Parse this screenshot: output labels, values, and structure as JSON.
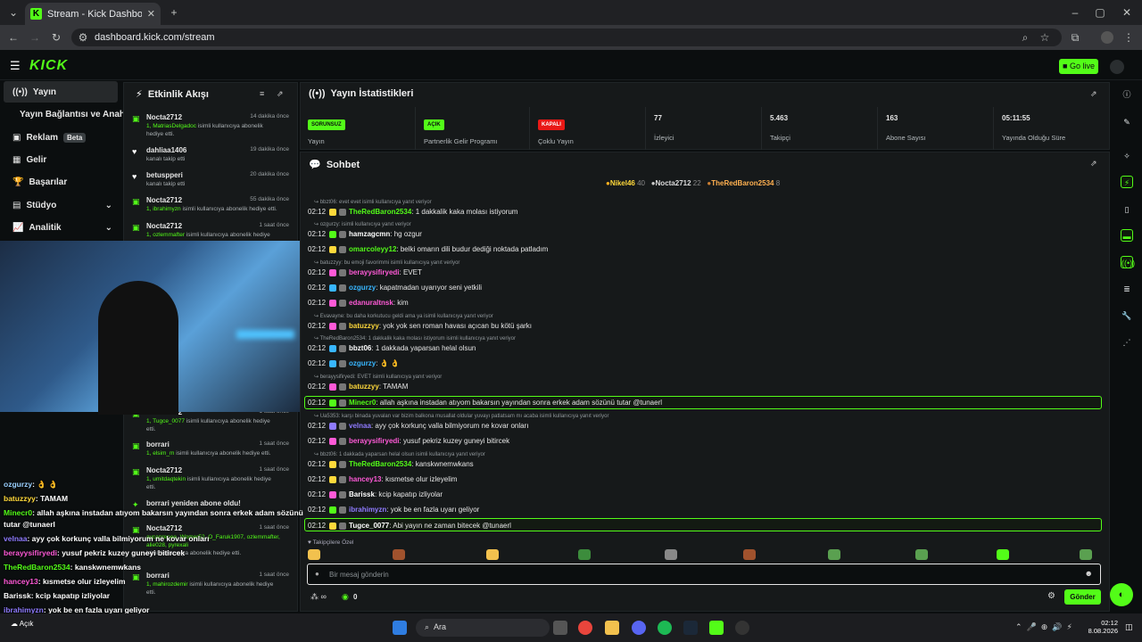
{
  "browser": {
    "tab_title": "Stream - Kick Dashboard",
    "url": "dashboard.kick.com/stream"
  },
  "header": {
    "logo": "KICK",
    "go_live": "Go live"
  },
  "sidebar": {
    "items": [
      {
        "label": "Yayın"
      },
      {
        "label": "Yayın Bağlantısı ve Anahtarı"
      },
      {
        "label": "Reklam",
        "badge": "Beta"
      },
      {
        "label": "Gelir"
      },
      {
        "label": "Başarılar"
      },
      {
        "label": "Stüdyo"
      },
      {
        "label": "Analitik"
      }
    ]
  },
  "activity": {
    "title": "Etkinlik Akışı",
    "items": [
      {
        "name": "Nocta2712",
        "time": "14 dakika önce",
        "line1_user": "1, MatriasDelgadoc",
        "line1": " isimli kullanıcıya abonelik",
        "line2": "hediye etti."
      },
      {
        "name": "dahliaa1406",
        "time": "19 dakika önce",
        "line1_user": "",
        "line1": "kanalı takip etti",
        "line2": ""
      },
      {
        "name": "betuspperi",
        "time": "20 dakika önce",
        "line1_user": "",
        "line1": "kanalı takip etti",
        "line2": ""
      },
      {
        "name": "Nocta2712",
        "time": "55 dakika önce",
        "line1_user": "1, ibrahimyzn",
        "line1": " isimli kullanıcıya abonelik hediye etti.",
        "line2": ""
      },
      {
        "name": "Nocta2712",
        "time": "1 saat önce",
        "line1_user": "1, ozlemmafter",
        "line1": " isimli kullanıcıya abonelik hediye",
        "line2": ""
      },
      {
        "name": "Nocta2712",
        "time": "1 saat önce",
        "line1_user": "1, Tugce_0077",
        "line1": " isimli kullanıcıya abonelik hediye",
        "line2": "etti."
      },
      {
        "name": "borrari",
        "time": "1 saat önce",
        "line1_user": "1, elsim_m",
        "line1": " isimli kullanıcıya abonelik hediye etti.",
        "line2": ""
      },
      {
        "name": "Nocta2712",
        "time": "1 saat önce",
        "line1_user": "1, umitdaqtekin",
        "line1": " isimli kullanıcıya abonelik hediye",
        "line2": "etti."
      },
      {
        "name": "borrari yeniden abone oldu!",
        "time": "",
        "line1_user": "",
        "line1": "",
        "line2": ""
      },
      {
        "name": "Nocta2712",
        "time": "1 saat önce",
        "line1_user": "aycanrenee, Womer52, O_Faruk1907, ozlemmafter, alie028, pyrexali",
        "line1": "",
        "line2": "isimli kullanıcıya abonelik hediye etti."
      },
      {
        "name": "borrari",
        "time": "1 saat önce",
        "line1_user": "1, mahirozdemir",
        "line1": " isimli kullanıcıya abonelik hediye",
        "line2": "etti."
      }
    ]
  },
  "stats": {
    "title": "Yayın İstatistikleri",
    "cells": [
      {
        "value": "SORUNSUZ",
        "label": "Yayın"
      },
      {
        "value": "AÇIK",
        "label": "Partnerlik Gelir Programı"
      },
      {
        "value": "KAPALI",
        "label": "Çoklu Yayın"
      },
      {
        "value": "77",
        "label": "İzleyici"
      },
      {
        "value": "5.463",
        "label": "Takipçi"
      },
      {
        "value": "163",
        "label": "Abone Sayısı"
      },
      {
        "value": "05:11:55",
        "label": "Yayında Olduğu Süre"
      }
    ]
  },
  "chat": {
    "title": "Sohbet",
    "leaderboard": [
      {
        "name": "Nikel46",
        "count": "40"
      },
      {
        "name": "Nocta2712",
        "count": "22"
      },
      {
        "name": "TheRedBaron2534",
        "count": "8"
      }
    ],
    "messages": [
      {
        "reply": "bbzt06: evet evet isimli kullanıcıya yanıt veriyor",
        "time": "02:12",
        "user": "TheRedBaron2534",
        "color": "#53fc18",
        "text": "1 dakkalik kaka molası istiyorum"
      },
      {
        "reply": "ozgurzy:  isimli kullanıcıya yanıt veriyor",
        "time": "02:12",
        "user": "hamzagcmn",
        "color": "#ffffff",
        "text": "hg ozgur"
      },
      {
        "reply": "",
        "time": "02:12",
        "user": "omarcoleyy12",
        "color": "#53fc18",
        "text": "belki omarın dili budur dediği noktada patladım"
      },
      {
        "reply": "batuzzyy: bu emoji favorimmi isimli kullanıcıya yanıt veriyor",
        "time": "02:12",
        "user": "berayysifiryedi",
        "color": "#ff5ad7",
        "text": "EVET"
      },
      {
        "reply": "",
        "time": "02:12",
        "user": "ozgurzy",
        "color": "#38b6ff",
        "text": "kapatmadan uyarıyor seni yetkili"
      },
      {
        "reply": "",
        "time": "02:12",
        "user": "edanuraltnsk",
        "color": "#ff5ad7",
        "text": "kim"
      },
      {
        "reply": "Evavayne: bu daha korkutucu geldi ama ya isimli kullanıcıya yanıt veriyor",
        "time": "02:12",
        "user": "batuzzyy",
        "color": "#ffd93b",
        "text": "yok yok sen roman havası açıcan bu kötü şarkı"
      },
      {
        "reply": "TheRedBaron2534: 1 dakkalik kaka molası istiyorum isimli kullanıcıya yanıt veriyor",
        "time": "02:12",
        "user": "bbzt06",
        "color": "#ffffff",
        "text": "1 dakkada yaparsan helal olsun"
      },
      {
        "reply": "",
        "time": "02:12",
        "user": "ozgurzy",
        "color": "#38b6ff",
        "text": "👌 👌"
      },
      {
        "reply": "berayysifiryedi: EVET isimli kullanıcıya yanıt veriyor",
        "time": "02:12",
        "user": "batuzzyy",
        "color": "#ffd93b",
        "text": "TAMAM"
      },
      {
        "reply": "",
        "time": "02:12",
        "user": "Minecr0",
        "color": "#53fc18",
        "text": "allah aşkına instadan atıyom bakarsın yayından sonra erkek adam sözünü tutar @tunaerl"
      },
      {
        "reply": "Ua5353: karşı binada yuvalan var bizim balkona musallat oldular yuvayı patlatsam mı acaba isimli kullanıcıya yanıt veriyor",
        "time": "02:12",
        "user": "velnaa",
        "color": "#8f7bff",
        "text": "ayy çok korkunç valla bilmiyorum ne kovar onları"
      },
      {
        "reply": "",
        "time": "02:12",
        "user": "berayysifiryedi",
        "color": "#ff5ad7",
        "text": "yusuf pekriz kuzey guneyi bitircek"
      },
      {
        "reply": "bbzt06: 1 dakkada yaparsan helal olsun isimli kullanıcıya yanıt veriyor",
        "time": "02:12",
        "user": "TheRedBaron2534",
        "color": "#53fc18",
        "text": "kanskwnemwkans"
      },
      {
        "reply": "",
        "time": "02:12",
        "user": "hancey13",
        "color": "#ff5ad7",
        "text": "kısmetse olur izleyelim"
      },
      {
        "reply": "",
        "time": "02:12",
        "user": "Barissk",
        "color": "#ffffff",
        "text": "kcip kapatıp izliyolar"
      },
      {
        "reply": "",
        "time": "02:12",
        "user": "ibrahimyzn",
        "color": "#8f7bff",
        "text": "yok be en fazla uyarı geliyor"
      },
      {
        "reply": "",
        "time": "02:12",
        "user": "Tugce_0077",
        "color": "#ffffff",
        "text": "Abi yayın ne zaman bitecek @tunaerl"
      }
    ],
    "emote_label": "Takipçilere Özel",
    "input_placeholder": "Bir mesaj gönderin",
    "points": "0",
    "send": "Gönder"
  },
  "overlay": {
    "lines": [
      {
        "user": "ozgurzy",
        "text": ": 👌 👌",
        "color": "#9ad0ff"
      },
      {
        "user": "batuzzyy",
        "text": ": TAMAM",
        "color": "#ffd93b"
      },
      {
        "user": "Minecr0",
        "text": ": allah aşkına instadan atıyom bakarsın yayından sonra erkek adam sözünü",
        "color": "#53fc18"
      },
      {
        "user": "",
        "text": "tutar @tunaerl",
        "color": "#ffffff"
      },
      {
        "user": "velnaa",
        "text": ": ayy çok korkunç valla bilmiyorum ne kovar onları",
        "color": "#8f7bff"
      },
      {
        "user": "berayysifiryedi",
        "text": ": yusuf pekriz kuzey guneyi bitircek",
        "color": "#ff5ad7"
      },
      {
        "user": "TheRedBaron2534",
        "text": ": kanskwnemwkans",
        "color": "#53fc18"
      },
      {
        "user": "hancey13",
        "text": ": kısmetse olur izleyelim",
        "color": "#ff5ad7"
      },
      {
        "user": "Barissk",
        "text": ": kcip kapatıp izliyolar",
        "color": "#ffffff"
      },
      {
        "user": "ibrahimyzn",
        "text": ": yok be en fazla uyarı geliyor",
        "color": "#8f7bff"
      },
      {
        "user": "Tugce_0077",
        "text": ": Abi yayın ne zaman bitecek @tunaerl",
        "color": "#ffffff"
      }
    ]
  },
  "taskbar": {
    "search": "Ara",
    "time": "02:12",
    "date": "8.08.2026",
    "weather": "Açık"
  },
  "colors": {
    "accent": "#53fc18",
    "bg": "#0b0e0f",
    "panel": "#16191a"
  }
}
